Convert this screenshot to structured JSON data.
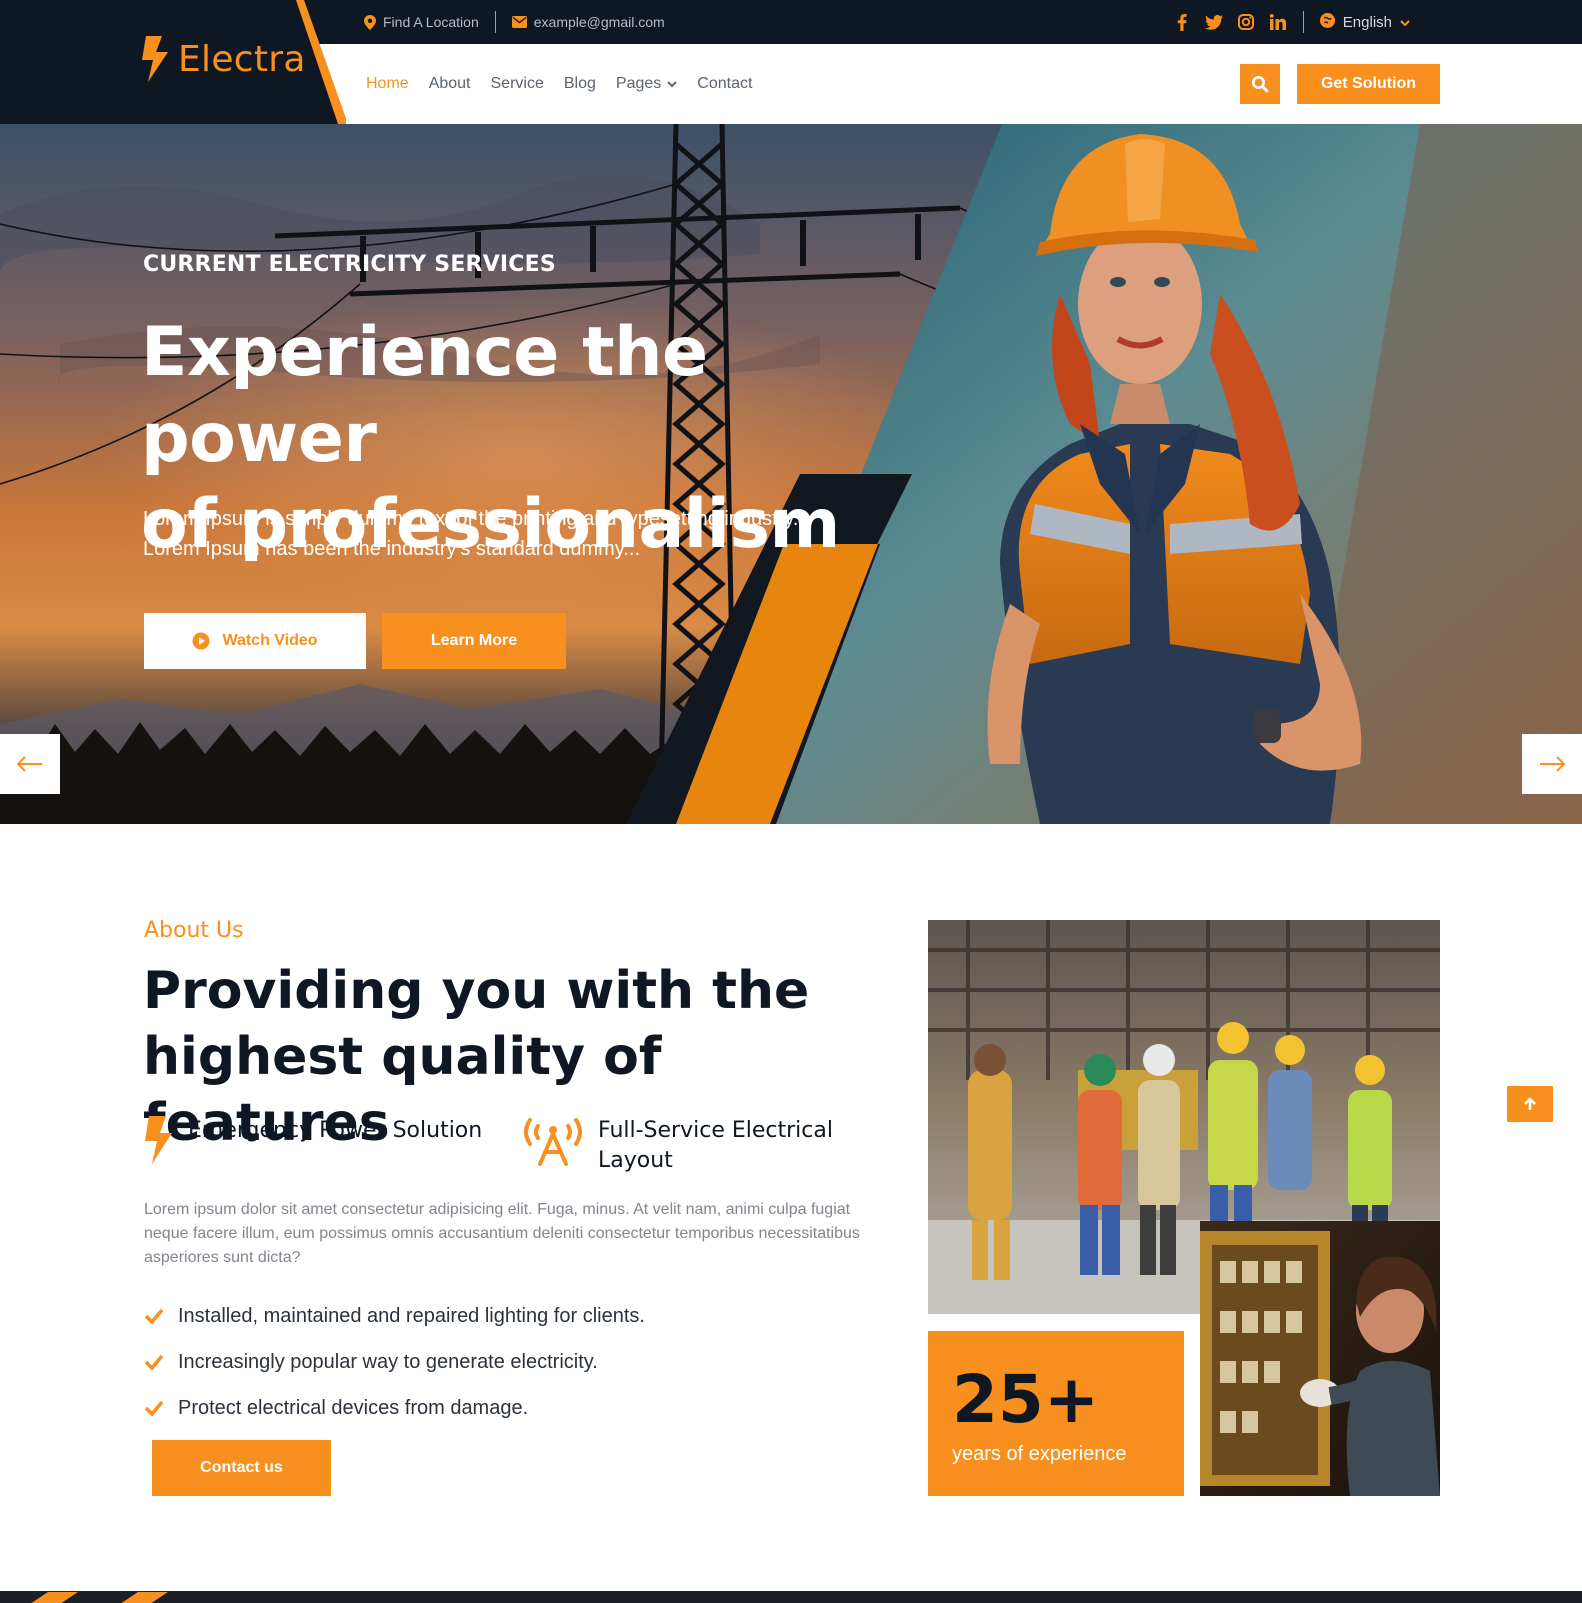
{
  "brand": {
    "name": "Electra",
    "accent": "#f7901e",
    "dark": "#0f1722"
  },
  "topbar": {
    "location": "Find A Location",
    "email": "example@gmail.com",
    "social_icons": [
      "facebook-icon",
      "twitter-icon",
      "instagram-icon",
      "linkedin-icon"
    ],
    "language": "English"
  },
  "nav": {
    "items": [
      {
        "label": "Home",
        "active": true
      },
      {
        "label": "About"
      },
      {
        "label": "Service"
      },
      {
        "label": "Blog"
      },
      {
        "label": "Pages",
        "dropdown": true
      },
      {
        "label": "Contact"
      }
    ],
    "cta": "Get Solution"
  },
  "hero": {
    "subtitle": "CURRENT ELECTRICITY SERVICES",
    "title_line1": "Experience the power",
    "title_line2": "of professionalism",
    "desc_line1": "Lorem Ipsum is simply dummy text of the printing and typesetting industry.",
    "desc_line2": "Lorem Ipsum has been the industry's standard dummy...",
    "watch_label": "Watch Video",
    "learn_label": "Learn More"
  },
  "about": {
    "label": "About Us",
    "title_line1": "Providing you with the",
    "title_line2": "highest quality of features",
    "feature1": "Emergency Power Solution",
    "feature2_line1": "Full-Service Electrical",
    "feature2_line2": "Layout",
    "desc": "Lorem ipsum dolor sit amet consectetur adipisicing elit. Fuga, minus. At velit nam, animi culpa fugiat neque facere illum, eum possimus omnis accusantium deleniti consectetur temporibus necessitatibus asperiores sunt dicta?",
    "checks": [
      "Installed, maintained and repaired lighting for clients.",
      "Increasingly popular way to generate electricity.",
      "Protect electrical devices from damage."
    ],
    "contact_label": "Contact us",
    "experience_number": "25+",
    "experience_label": "years of experience"
  }
}
